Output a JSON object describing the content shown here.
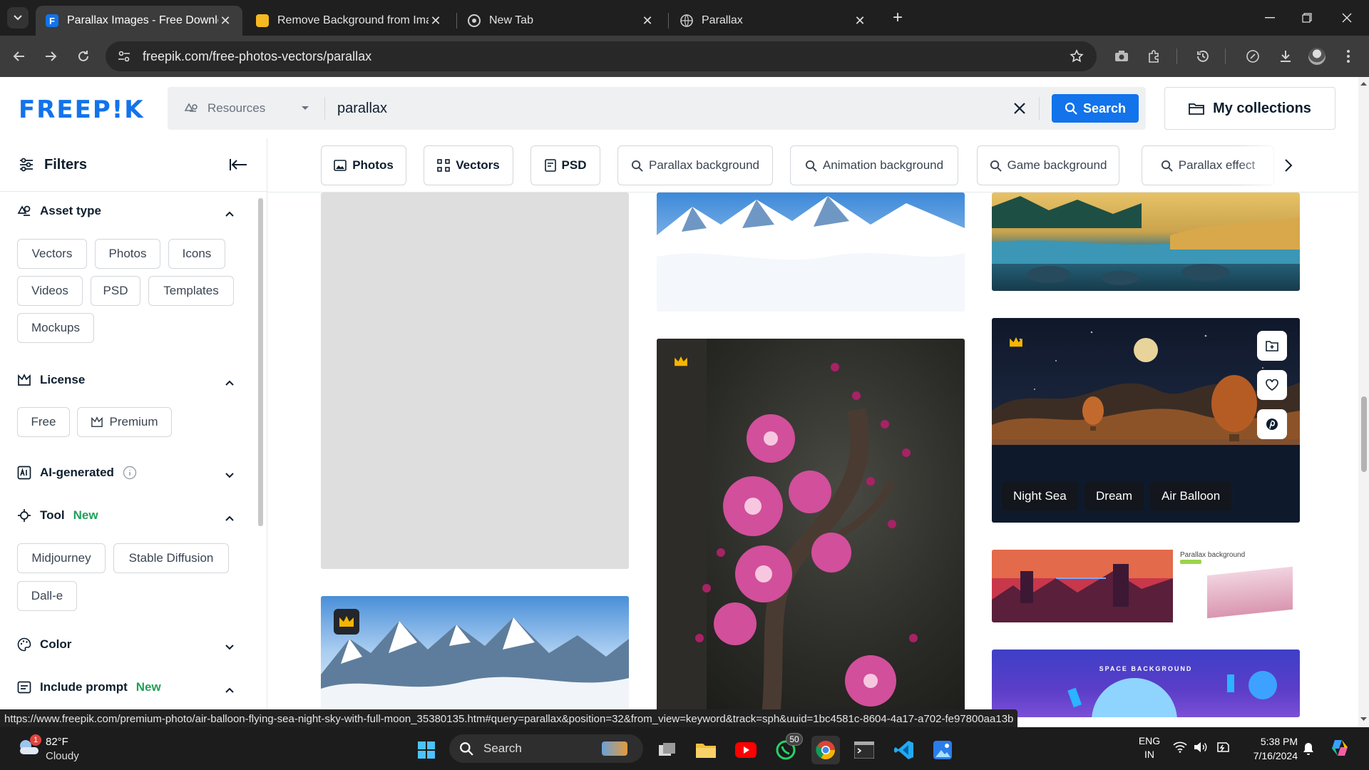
{
  "browser": {
    "tabs": [
      {
        "title": "Parallax Images - Free Downloa",
        "active": true
      },
      {
        "title": "Remove Background from Imag",
        "active": false
      },
      {
        "title": "New Tab",
        "active": false
      },
      {
        "title": "Parallax",
        "active": false
      }
    ],
    "url": "freepik.com/free-photos-vectors/parallax"
  },
  "header": {
    "logo": "FREEP!K",
    "resource_select": "Resources",
    "search_value": "parallax",
    "search_button": "Search",
    "collections_button": "My collections"
  },
  "sidebar": {
    "title": "Filters",
    "asset_type": {
      "title": "Asset type",
      "options": [
        "Vectors",
        "Photos",
        "Icons",
        "Videos",
        "PSD",
        "Templates",
        "Mockups"
      ]
    },
    "license": {
      "title": "License",
      "options": [
        "Free",
        "Premium"
      ]
    },
    "ai_generated": {
      "title": "AI-generated"
    },
    "tool": {
      "title": "Tool",
      "badge": "New",
      "options": [
        "Midjourney",
        "Stable Diffusion",
        "Dall-e"
      ]
    },
    "color": {
      "title": "Color"
    },
    "include_prompt": {
      "title": "Include prompt",
      "badge": "New"
    }
  },
  "quick_filters": [
    "Photos",
    "Vectors",
    "PSD",
    "Parallax background",
    "Animation background",
    "Game background",
    "Parallax effect"
  ],
  "results": {
    "hover_tags": [
      "Night Sea",
      "Dream",
      "Air Balloon"
    ],
    "thumb_caption": "Parallax background",
    "space_caption": "SPACE BACKGROUND"
  },
  "status_url": "https://www.freepik.com/premium-photo/air-balloon-flying-sea-night-sky-with-full-moon_35380135.htm#query=parallax&position=32&from_view=keyword&track=sph&uuid=1bc4581c-8604-4a17-a702-fe97800aa13b",
  "taskbar": {
    "weather_temp": "82°F",
    "weather_desc": "Cloudy",
    "weather_badge": "1",
    "search_label": "Search",
    "whatsapp_badge": "50",
    "lang_top": "ENG",
    "lang_bottom": "IN",
    "time": "5:38 PM",
    "date": "7/16/2024"
  },
  "colors": {
    "brand": "#1273eb",
    "new_badge": "#1fa058",
    "premium_crown": "#f7b500"
  }
}
